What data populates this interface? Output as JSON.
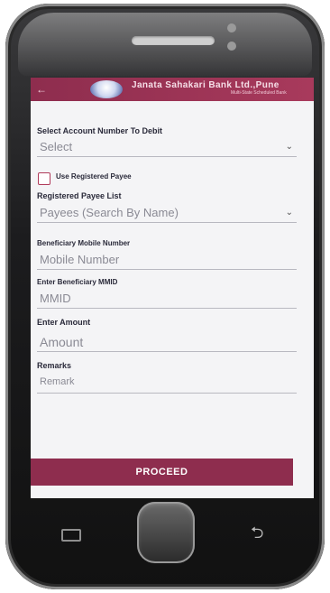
{
  "header": {
    "back_glyph": "←",
    "bank_name": "Janata Sahakari Bank Ltd.,Pune",
    "bank_subtitle": "Multi-State Scheduled Bank"
  },
  "form": {
    "account": {
      "label": "Select Account Number To Debit",
      "value": "Select"
    },
    "use_registered": {
      "label": "Use Registered Payee",
      "checked": false
    },
    "payee": {
      "label": "Registered Payee List",
      "placeholder": "Payees (Search By Name)"
    },
    "mobile": {
      "label": "Beneficiary Mobile Number",
      "placeholder": "Mobile Number"
    },
    "mmid": {
      "label": "Enter Beneficiary MMID",
      "placeholder": "MMID"
    },
    "amount": {
      "label": "Enter Amount",
      "placeholder": "Amount"
    },
    "remarks": {
      "label": "Remarks",
      "placeholder": "Remark"
    }
  },
  "actions": {
    "proceed_label": "PROCEED"
  },
  "icons": {
    "back": "back-arrow-icon",
    "logo": "bank-logo-icon",
    "chevron": "chevron-down-icon",
    "menu": "menu-icon",
    "device_back": "back-return-icon"
  },
  "colors": {
    "accent": "#8e2d4e",
    "background": "#f4f4f6"
  }
}
